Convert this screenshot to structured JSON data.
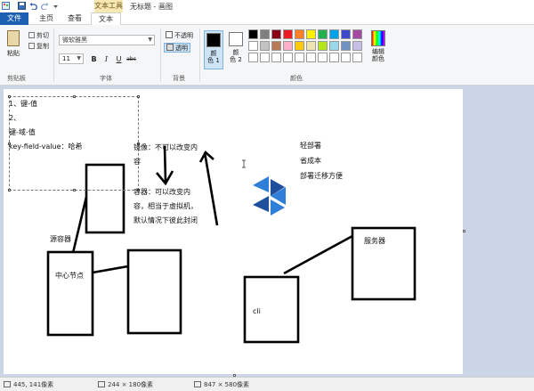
{
  "window": {
    "context_tab": "文本工具",
    "title": "无标题 - 画图"
  },
  "tabs": [
    {
      "label": "文件"
    },
    {
      "label": "主页"
    },
    {
      "label": "查看"
    },
    {
      "label": "文本"
    }
  ],
  "clipboard": {
    "paste_label": "粘贴",
    "cut_label": "剪切",
    "copy_label": "复制",
    "group_label": "剪贴板"
  },
  "font": {
    "family": "微软雅黑",
    "size": "11",
    "group_label": "字体"
  },
  "background": {
    "opaque_label": "不透明",
    "transparent_label": "透明",
    "group_label": "背景"
  },
  "colors": {
    "color1_label": "颜\n色 1",
    "color2_label": "颜\n色 2",
    "edit_label": "编辑\n颜色",
    "group_label": "颜色",
    "color1": "#000000",
    "color2": "#ffffff",
    "palette_row1": [
      "#000000",
      "#7f7f7f",
      "#880015",
      "#ed1c24",
      "#ff7f27",
      "#fff200",
      "#22b14c",
      "#00a2e8",
      "#3f48cc",
      "#a349a4"
    ],
    "palette_row2": [
      "#ffffff",
      "#c3c3c3",
      "#b97a57",
      "#ffaec9",
      "#ffc90e",
      "#efe4b0",
      "#b5e61d",
      "#99d9ea",
      "#7092be",
      "#c8bfe7"
    ],
    "palette_row3": [
      "#ffffff",
      "#ffffff",
      "#ffffff",
      "#ffffff",
      "#ffffff",
      "#ffffff",
      "#ffffff",
      "#ffffff",
      "#ffffff",
      "#ffffff"
    ]
  },
  "canvas_text": {
    "kv1": "1、键-值",
    "kv2": "2、",
    "kv3": "键-域-值",
    "kv4": "key-field-value：哈希",
    "mirror_a": "镜像：不可以改变内",
    "mirror_b": "容",
    "container_a": "容器：可以改变内",
    "container_b": "容，相当于虚拟机，",
    "container_c": "默认情况下彼此封闭",
    "right_a": "轻部署",
    "right_b": "省成本",
    "right_c": "部署迁移方便",
    "source_container": "源容器",
    "center_node": "中心节点",
    "server": "服务器",
    "cli": "cli"
  },
  "status": {
    "cursor_pos": "445, 141像素",
    "selection_size": "244 × 180像素",
    "image_size": "847 × 580像素"
  }
}
